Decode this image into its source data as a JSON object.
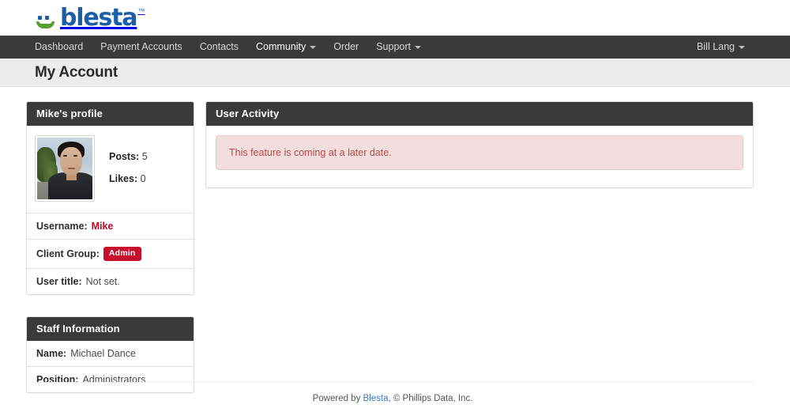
{
  "brand": {
    "name": "blesta",
    "trademark": "™",
    "logo_blue": "#1a5fa8",
    "logo_green": "#5a9e2f"
  },
  "nav": {
    "items": [
      {
        "label": "Dashboard",
        "has_caret": false,
        "active": false
      },
      {
        "label": "Payment Accounts",
        "has_caret": false,
        "active": false
      },
      {
        "label": "Contacts",
        "has_caret": false,
        "active": false
      },
      {
        "label": "Community",
        "has_caret": true,
        "active": true
      },
      {
        "label": "Order",
        "has_caret": false,
        "active": false
      },
      {
        "label": "Support",
        "has_caret": true,
        "active": false
      }
    ],
    "user": {
      "label": "Bill Lang",
      "has_caret": true
    }
  },
  "page": {
    "title": "My Account"
  },
  "profile_panel": {
    "heading": "Mike's profile",
    "avatar_alt": "Mike profile photo",
    "stats": [
      {
        "label": "Posts:",
        "value": "5"
      },
      {
        "label": "Likes:",
        "value": "0"
      }
    ],
    "rows": [
      {
        "label": "Username:",
        "value": "Mike",
        "style": "red-text"
      },
      {
        "label": "Client Group:",
        "value": "Admin",
        "style": "badge"
      },
      {
        "label": "User title:",
        "value": "Not set.",
        "style": "plain"
      }
    ]
  },
  "staff_panel": {
    "heading": "Staff Information",
    "rows": [
      {
        "label": "Name:",
        "value": "Michael Dance"
      },
      {
        "label": "Position:",
        "value": "Administrators"
      }
    ]
  },
  "activity_panel": {
    "heading": "User Activity",
    "alert_text": "This feature is coming at a later date.",
    "alert_bg": "#f2dede",
    "alert_color": "#b94a48"
  },
  "footer": {
    "prefix": "Powered by ",
    "link": "Blesta",
    "suffix": ", © Phillips Data, Inc."
  }
}
